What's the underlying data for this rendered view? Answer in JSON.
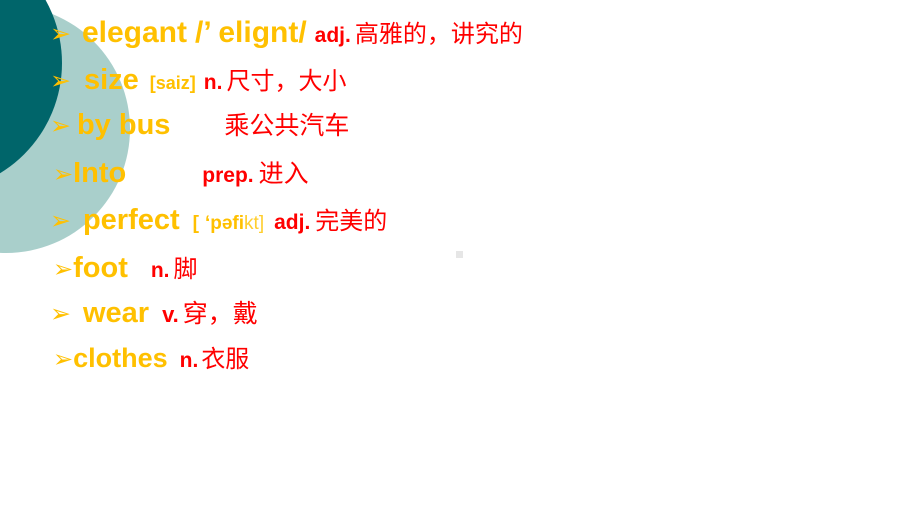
{
  "slide": {
    "background_color": "#FFFFFF",
    "accent_word_color": "#FFC000",
    "accent_meaning_color": "#FF0000",
    "decor": {
      "dark_circle_color": "#00656A",
      "light_circle_color": "#A9CFCB"
    },
    "bullet_glyph": "➢"
  },
  "vocabulary": [
    {
      "id": "elegant",
      "bullet": "➢",
      "lead_space": " ",
      "word": "elegant",
      "phonetic": "/’ elignt/",
      "gap1": " ",
      "pos": "adj.",
      "gap2": " ",
      "meaning": "高雅的，讲究的"
    },
    {
      "id": "size",
      "bullet": "➢",
      "lead_space": " ",
      "word": "size",
      "phonetic": "[saiz]",
      "gap1": "  ",
      "pos": "n.",
      "gap2": " ",
      "meaning": "尺寸，大小"
    },
    {
      "id": "by-bus",
      "bullet": "➢",
      "lead_space": "",
      "word": "by bus",
      "phonetic": "",
      "gap1": "",
      "pos": "",
      "gap2": "",
      "meaning": "乘公共汽车"
    },
    {
      "id": "into",
      "bullet": "➢",
      "lead_space": "",
      "word": "Into",
      "phonetic": "",
      "gap1": "",
      "pos": "prep.",
      "gap2": " ",
      "meaning": "进入"
    },
    {
      "id": "perfect",
      "bullet": "➢",
      "lead_space": " ",
      "word": "perfect",
      "phonetic_open": "[",
      "phonetic_stress": "‘pəfi",
      "phonetic_tail": "kt]",
      "gap1": "  ",
      "pos": "adj.",
      "gap2": " ",
      "meaning": "完美的"
    },
    {
      "id": "foot",
      "bullet": "➢",
      "lead_space": "",
      "word": "foot",
      "phonetic": "",
      "gap1": "",
      "pos": "n.",
      "gap2": " ",
      "meaning": "脚"
    },
    {
      "id": "wear",
      "bullet": "➢",
      "lead_space": " ",
      "word": "wear",
      "phonetic": "",
      "gap1": "",
      "pos": "v.",
      "gap2": " ",
      "meaning": "穿，戴"
    },
    {
      "id": "clothes",
      "bullet": "➢",
      "lead_space": "",
      "word": "clothes",
      "phonetic": "",
      "gap1": "",
      "pos": "n.",
      "gap2": " ",
      "meaning": "衣服"
    }
  ]
}
